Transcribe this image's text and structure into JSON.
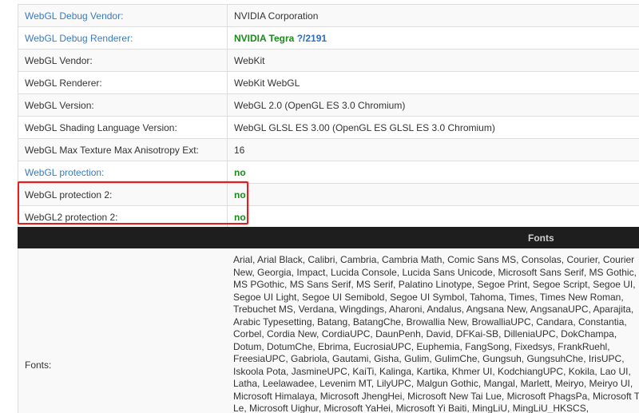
{
  "rows": [
    {
      "label": "WebGL Debug Vendor:",
      "value": "NVIDIA Corporation",
      "label_style": "link",
      "value_style": "plain"
    },
    {
      "label": "WebGL Debug Renderer:",
      "value": "NVIDIA Tegra ",
      "value_extra": "?/2191",
      "label_style": "link",
      "value_style": "green"
    },
    {
      "label": "WebGL Vendor:",
      "value": "WebKit",
      "label_style": "plain",
      "value_style": "plain"
    },
    {
      "label": "WebGL Renderer:",
      "value": "WebKit WebGL",
      "label_style": "plain",
      "value_style": "plain"
    },
    {
      "label": "WebGL Version:",
      "value": "WebGL 2.0 (OpenGL ES 3.0 Chromium)",
      "label_style": "plain",
      "value_style": "plain"
    },
    {
      "label": "WebGL Shading Language Version:",
      "value": "WebGL GLSL ES 3.00 (OpenGL ES GLSL ES 3.0 Chromium)",
      "label_style": "plain",
      "value_style": "plain"
    },
    {
      "label": "WebGL Max Texture Max Anisotropy Ext:",
      "value": "16",
      "label_style": "plain",
      "value_style": "plain"
    },
    {
      "label": "WebGL protection:",
      "value": "no",
      "label_style": "link",
      "value_style": "green"
    },
    {
      "label": "WebGL protection 2:",
      "value": "no",
      "label_style": "plain",
      "value_style": "green"
    },
    {
      "label": "WebGL2 protection 2:",
      "value": "no",
      "label_style": "plain",
      "value_style": "green"
    }
  ],
  "fonts_section": {
    "header": "Fonts",
    "label": "Fonts:",
    "list": "Arial, Arial Black, Calibri, Cambria, Cambria Math, Comic Sans MS, Consolas, Courier, Courier New, Georgia, Impact, Lucida Console, Lucida Sans Unicode, Microsoft Sans Serif, MS Gothic, MS PGothic, MS Sans Serif, MS Serif, Palatino Linotype, Segoe Print, Segoe Script, Segoe UI, Segoe UI Light, Segoe UI Semibold, Segoe UI Symbol, Tahoma, Times, Times New Roman, Trebuchet MS, Verdana, Wingdings, Aharoni, Andalus, Angsana New, AngsanaUPC, Aparajita, Arabic Typesetting, Batang, BatangChe, Browallia New, BrowalliaUPC, Candara, Constantia, Corbel, Cordia New, CordiaUPC, DaunPenh, David, DFKai-SB, DilleniaUPC, DokChampa, Dotum, DotumChe, Ebrima, EucrosiaUPC, Euphemia, FangSong, Fixedsys, FrankRuehl, FreesiaUPC, Gabriola, Gautami, Gisha, Gulim, GulimChe, Gungsuh, GungsuhChe, IrisUPC, Iskoola Pota, JasmineUPC, KaiTi, Kalinga, Kartika, Khmer UI, KodchiangUPC, Kokila, Lao UI, Latha, Leelawadee, Levenim MT, LilyUPC, Malgun Gothic, Mangal, Marlett, Meiryo, Meiryo UI, Microsoft Himalaya, Microsoft JhengHei, Microsoft New Tai Lue, Microsoft PhagsPa, Microsoft Tai Le, Microsoft Uighur, Microsoft YaHei, Microsoft Yi Baiti, MingLiU, MingLiU_HKSCS, MingLiU_HKSCS-"
  },
  "colors": {
    "link": "#3a7bbf",
    "green_value": "#1a8a1a",
    "highlight_border": "#e02020",
    "header_bg": "#1e1e1e"
  }
}
